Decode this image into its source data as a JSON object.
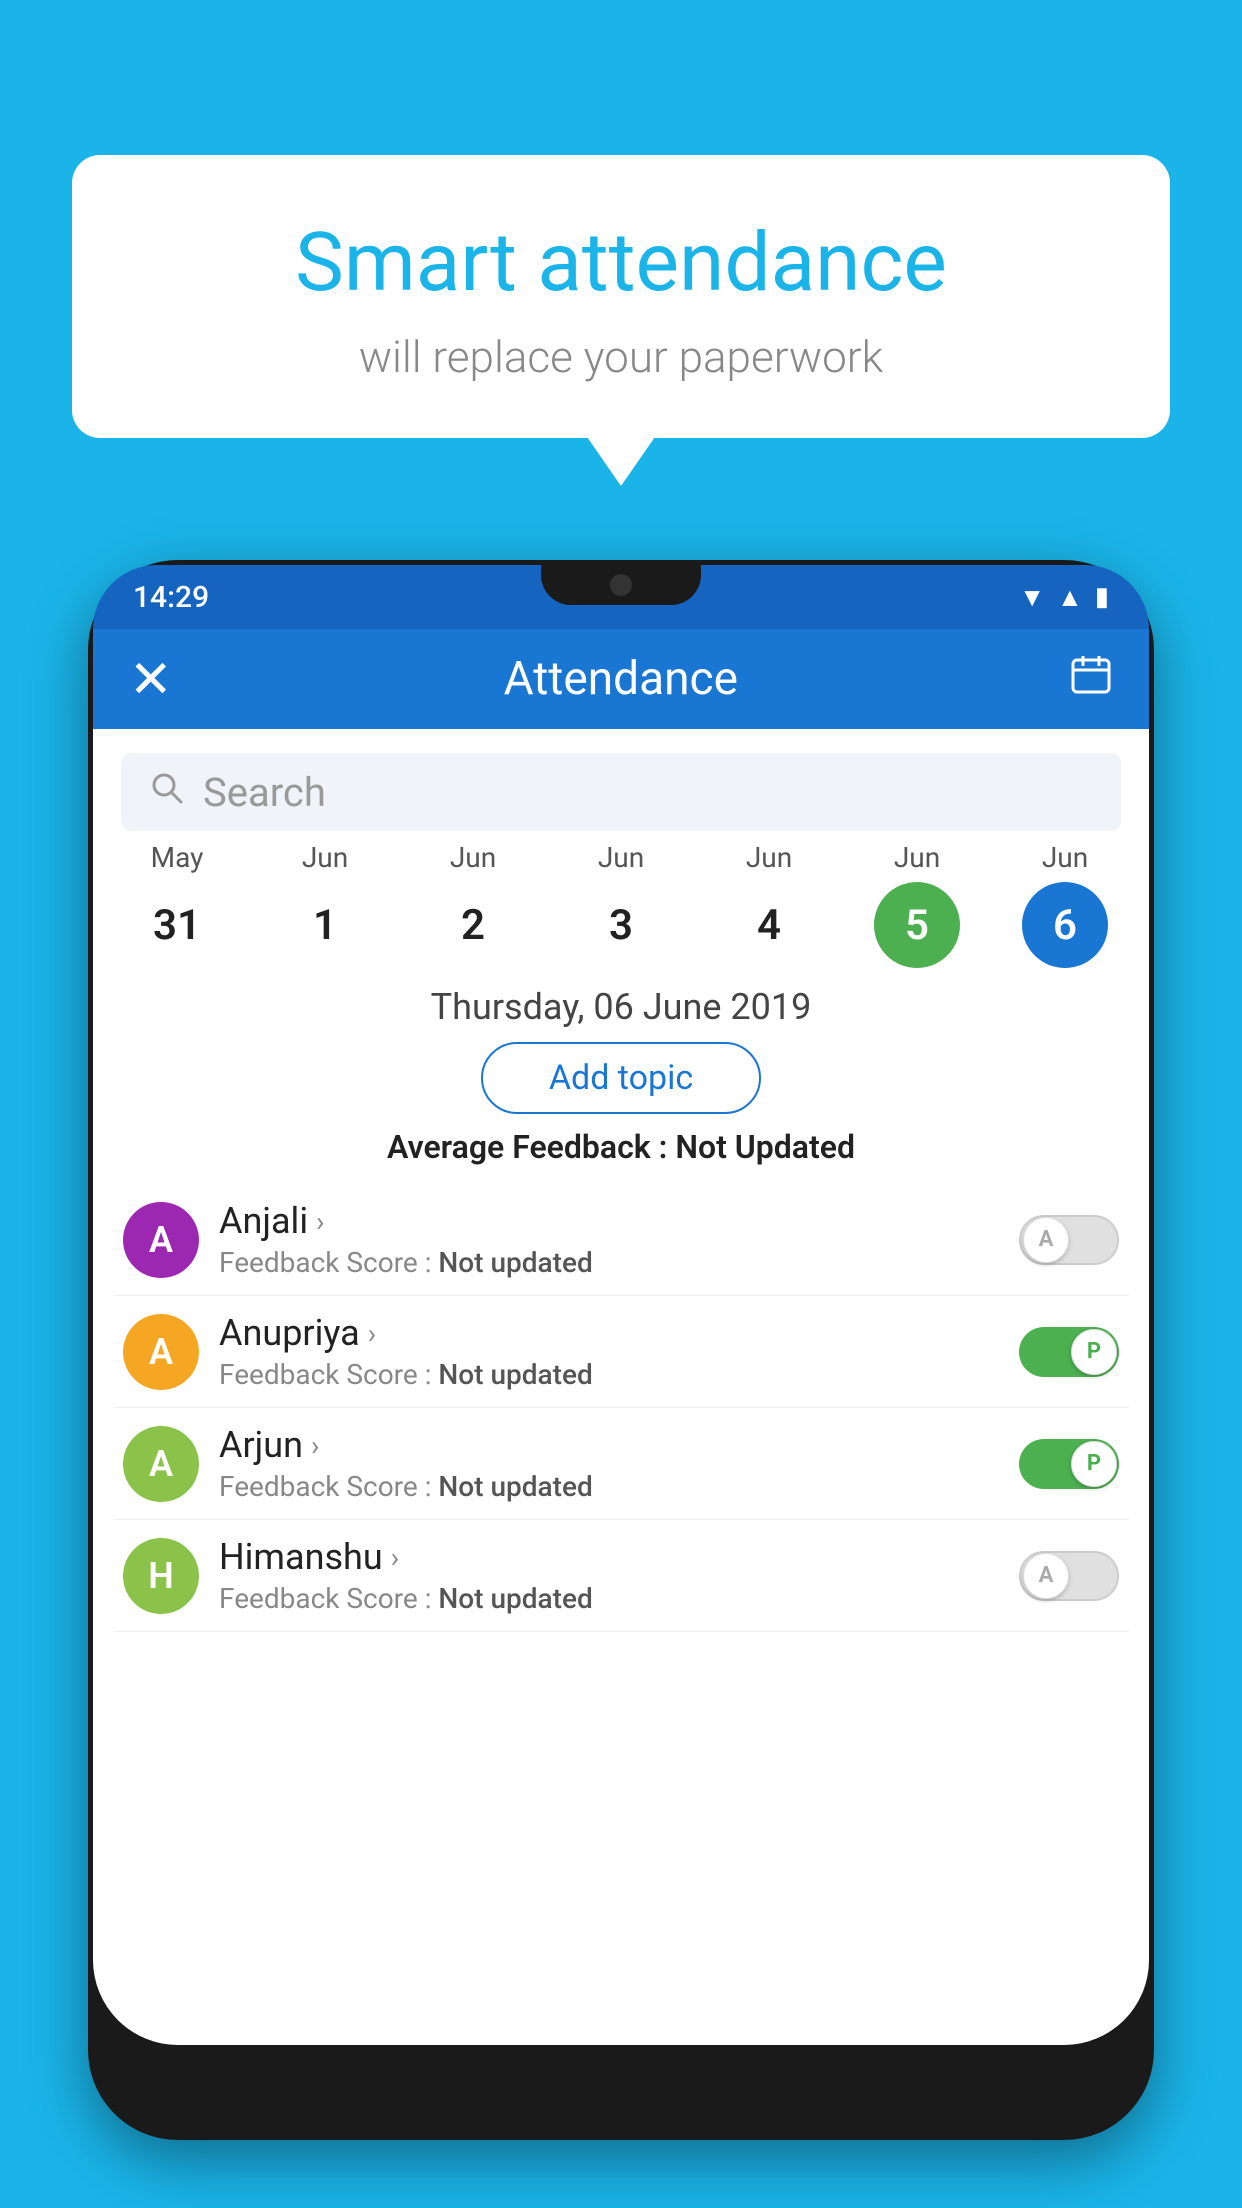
{
  "background_color": "#1ab4e8",
  "bubble": {
    "title": "Smart attendance",
    "subtitle": "will replace your paperwork"
  },
  "status_bar": {
    "time": "14:29",
    "wifi": "▾",
    "signal": "▴",
    "battery": "▮"
  },
  "app_bar": {
    "title": "Attendance",
    "close_label": "×",
    "calendar_label": "📅"
  },
  "search": {
    "placeholder": "Search"
  },
  "calendar": {
    "columns": [
      {
        "month": "May",
        "day": "31",
        "style": "normal"
      },
      {
        "month": "Jun",
        "day": "1",
        "style": "normal"
      },
      {
        "month": "Jun",
        "day": "2",
        "style": "normal"
      },
      {
        "month": "Jun",
        "day": "3",
        "style": "normal"
      },
      {
        "month": "Jun",
        "day": "4",
        "style": "normal"
      },
      {
        "month": "Jun",
        "day": "5",
        "style": "today"
      },
      {
        "month": "Jun",
        "day": "6",
        "style": "selected"
      }
    ]
  },
  "selected_date": "Thursday, 06 June 2019",
  "add_topic_label": "Add topic",
  "avg_feedback": {
    "label": "Average Feedback : ",
    "value": "Not Updated"
  },
  "students": [
    {
      "name": "Anjali",
      "avatar_letter": "A",
      "avatar_color": "#9c27b0",
      "feedback": "Feedback Score : ",
      "feedback_value": "Not updated",
      "toggle": "off",
      "toggle_letter": "A"
    },
    {
      "name": "Anupriya",
      "avatar_letter": "A",
      "avatar_color": "#f5a623",
      "feedback": "Feedback Score : ",
      "feedback_value": "Not updated",
      "toggle": "on",
      "toggle_letter": "P"
    },
    {
      "name": "Arjun",
      "avatar_letter": "A",
      "avatar_color": "#8bc34a",
      "feedback": "Feedback Score : ",
      "feedback_value": "Not updated",
      "toggle": "on",
      "toggle_letter": "P"
    },
    {
      "name": "Himanshu",
      "avatar_letter": "H",
      "avatar_color": "#8bc34a",
      "feedback": "Feedback Score : ",
      "feedback_value": "Not updated",
      "toggle": "off",
      "toggle_letter": "A"
    }
  ]
}
